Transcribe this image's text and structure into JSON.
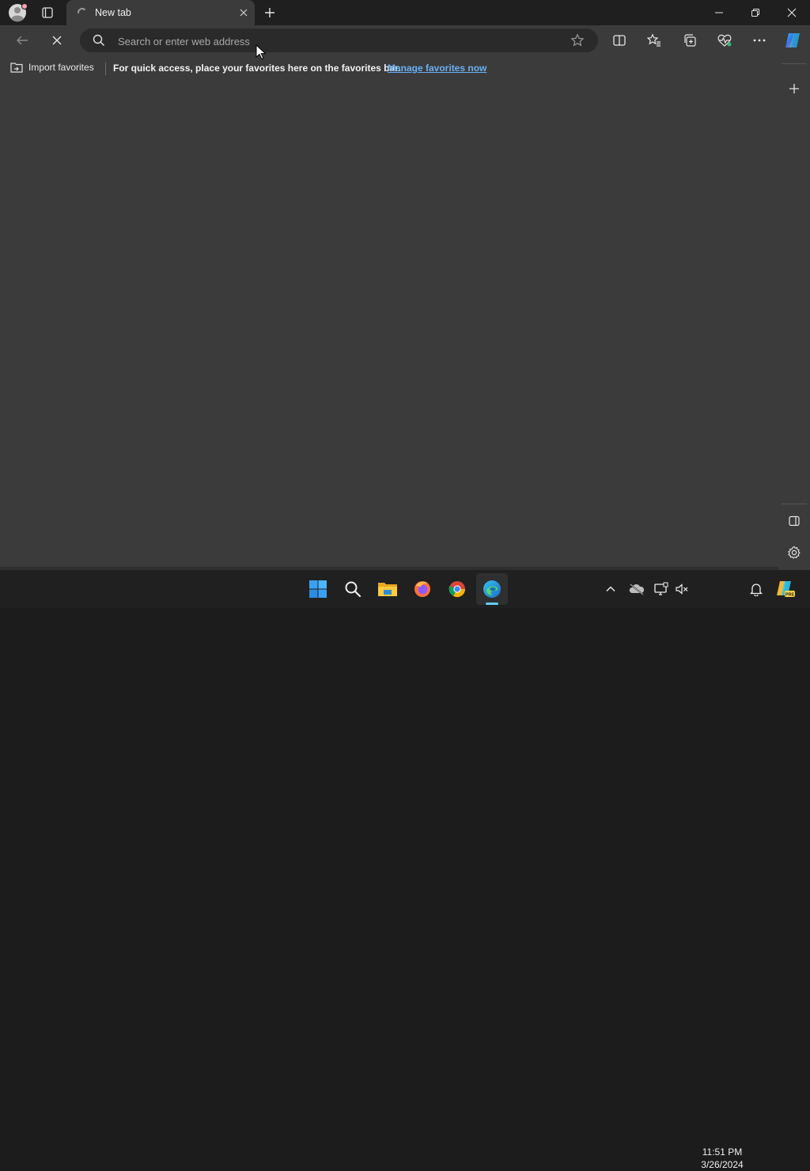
{
  "browser": {
    "tab": {
      "title": "New tab"
    },
    "address_bar": {
      "placeholder": "Search or enter web address",
      "value": ""
    },
    "favorites_bar": {
      "import_label": "Import favorites",
      "message": "For quick access, place your favorites here on the favorites bar.",
      "link": "Manage favorites now"
    }
  },
  "taskbar": {
    "clock": {
      "time": "11:51 PM",
      "date": "3/26/2024"
    }
  },
  "colors": {
    "accent_link": "#6ab0f5",
    "taskbar_active": "#60cdff",
    "chrome_dark": "#1f1f1f",
    "surface": "#3b3b3b"
  },
  "icons": [
    "profile-avatar-icon",
    "tab-actions-icon",
    "tab-spinner-icon",
    "close-icon",
    "plus-icon",
    "minimize-icon",
    "restore-icon",
    "window-close-icon",
    "back-arrow-icon",
    "stop-icon",
    "search-icon",
    "star-outline-icon",
    "split-screen-icon",
    "favorites-icon",
    "collections-icon",
    "browser-essentials-icon",
    "more-icon",
    "copilot-icon",
    "sidebar-toggle-icon",
    "gear-icon",
    "windows-start-icon",
    "file-explorer-icon",
    "firefox-icon",
    "chrome-icon",
    "edge-icon",
    "chevron-up-icon",
    "onedrive-icon",
    "display-icon",
    "speaker-muted-icon",
    "bell-icon"
  ]
}
